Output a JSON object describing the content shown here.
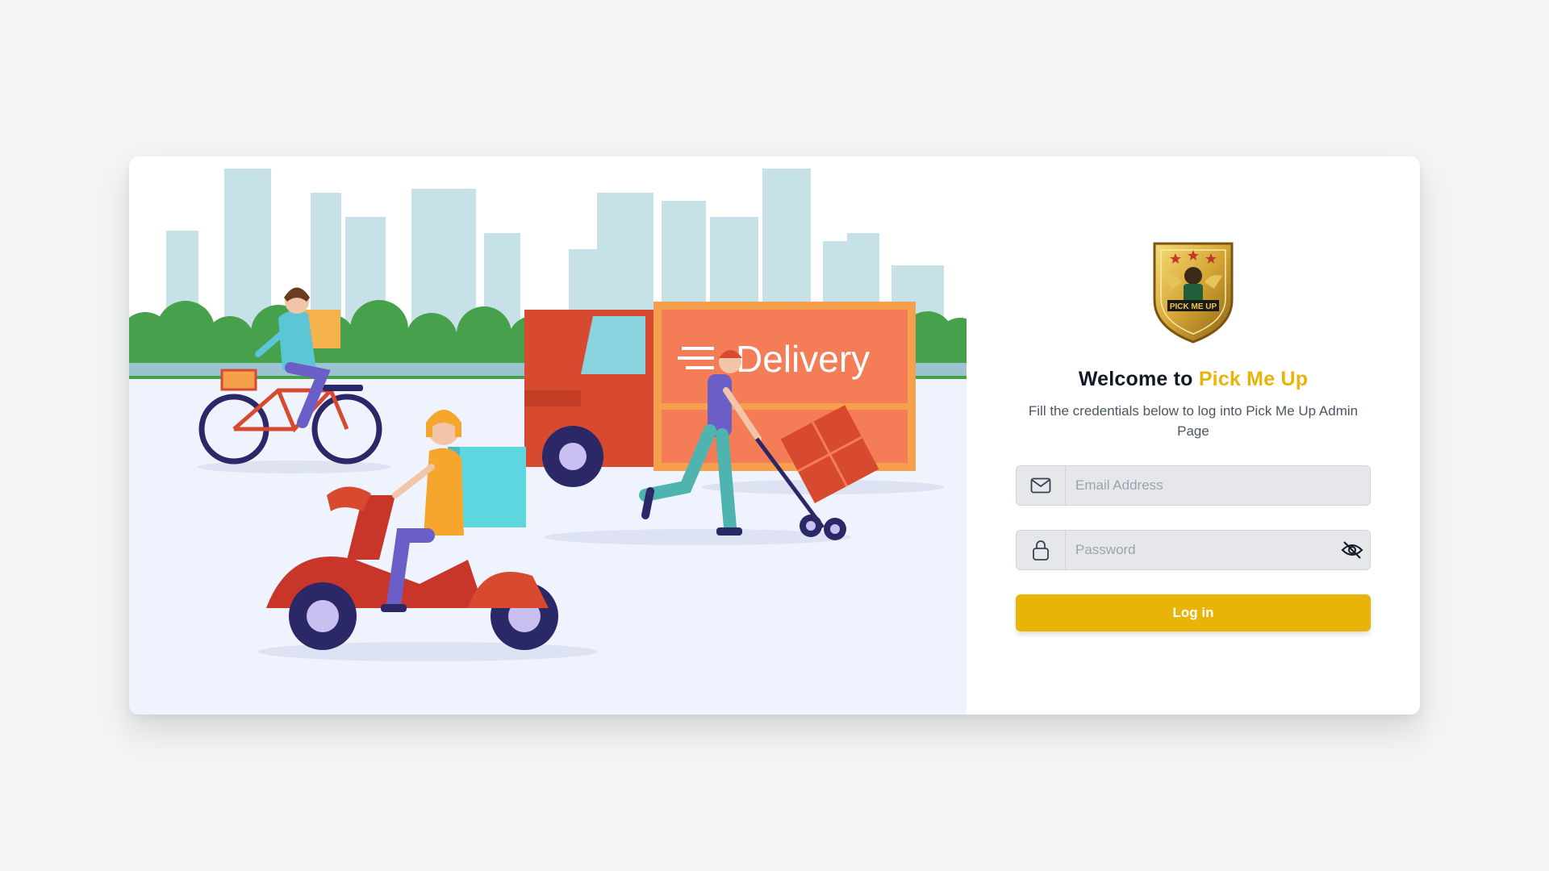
{
  "illustration": {
    "truck_text": "Delivery"
  },
  "logo": {
    "text": "PICK ME UP"
  },
  "welcome": {
    "prefix": "Welcome to ",
    "brand": "Pick Me Up",
    "subtitle": "Fill the credentials below to log into Pick Me Up Admin Page"
  },
  "form": {
    "email_placeholder": "Email Address",
    "email_value": "",
    "password_placeholder": "Password",
    "password_value": "",
    "submit_label": "Log in"
  },
  "icons": {
    "email": "mail-icon",
    "password": "lock-icon",
    "toggle": "eye-off-icon"
  },
  "colors": {
    "brand": "#eab308",
    "page_bg": "#f3f4f6",
    "text": "#111827"
  }
}
